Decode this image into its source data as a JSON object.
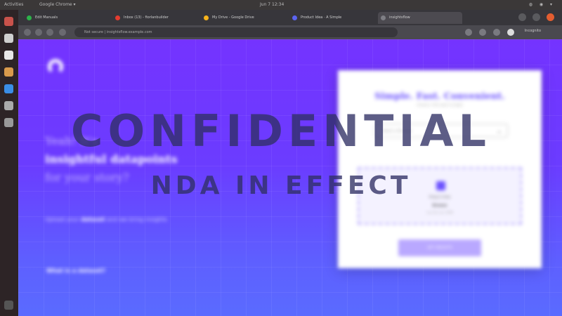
{
  "system_bar": {
    "activities": "Activities",
    "app": "Google Chrome ▾",
    "clock": "Jun 7  12:34"
  },
  "tabs": [
    {
      "label": "Edit Manuals",
      "color": "#2cb24a",
      "active": false
    },
    {
      "label": "Inbox (13) - fiorlanbuilder",
      "color": "#e33c2f",
      "active": false
    },
    {
      "label": "My Drive - Google Drive",
      "color": "#f6b31b",
      "active": false
    },
    {
      "label": "Product Idea · A Simple",
      "color": "#5b64f0",
      "active": false
    },
    {
      "label": "insightsflow",
      "color": "#7f7f85",
      "active": true
    }
  ],
  "address_bar": {
    "url": "Not secure  |  insightsflow.example.com",
    "profile": "Incognito"
  },
  "page": {
    "headline_pre": "Yeah! It's",
    "headline_mid": "insightful datapoints",
    "headline_post": "for your story?",
    "upload_pre": "Upload your",
    "upload_bold": "dataset",
    "upload_post": "and we bring insights",
    "what_link": "What is a dataset?"
  },
  "card": {
    "title": "Simple. Fast. Convenient.",
    "subtitle": "choose a file type to begin",
    "select_placeholder": "Select a file type",
    "drop_text": "Drag & drop",
    "drop_browse": "Browse",
    "drop_hint": "max file size 10MB",
    "button": "GET INSIGHTS"
  },
  "overlay": {
    "line1": "CONFIDENTIAL",
    "line2": "NDA IN EFFECT"
  }
}
